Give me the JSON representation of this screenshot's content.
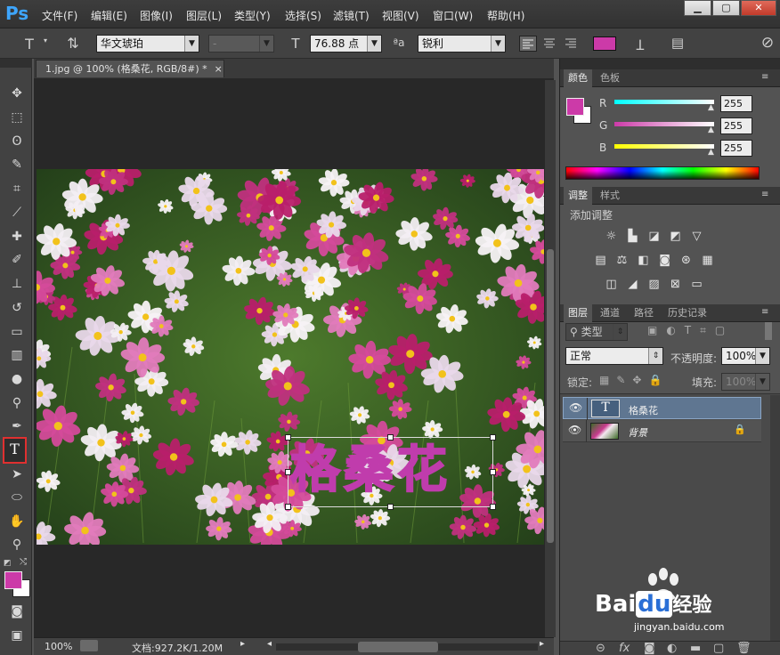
{
  "app": {
    "logo": "Ps",
    "menu": [
      "文件(F)",
      "编辑(E)",
      "图像(I)",
      "图层(L)",
      "类型(Y)",
      "选择(S)",
      "滤镜(T)",
      "视图(V)",
      "窗口(W)",
      "帮助(H)"
    ],
    "window_buttons": [
      "▁",
      "▢",
      "✕"
    ]
  },
  "options": {
    "font_family": "华文琥珀",
    "font_style": "-",
    "font_size": "76.88 点",
    "antialias_icon": "ªa",
    "antialias": "锐利",
    "text_color": "#cc3aa8"
  },
  "document": {
    "tab_title": "1.jpg @ 100% (格桑花, RGB/8#) *",
    "close": "×",
    "text_overlay": "格桑花",
    "text_color": "#c03cac"
  },
  "status": {
    "zoom": "100%",
    "doc_info": "文档:927.2K/1.20M"
  },
  "color_panel": {
    "tabs": [
      "颜色",
      "色板"
    ],
    "fg_color": "#cc3aa8",
    "bg_color": "#ffffff",
    "channels": [
      {
        "label": "R",
        "value": "255"
      },
      {
        "label": "G",
        "value": "255"
      },
      {
        "label": "B",
        "value": "255"
      }
    ]
  },
  "adjust_panel": {
    "tabs": [
      "调整",
      "样式"
    ],
    "title": "添加调整"
  },
  "layers_panel": {
    "tabs": [
      "图层",
      "通道",
      "路径",
      "历史记录"
    ],
    "filter": "类型",
    "blend_mode": "正常",
    "opacity_label": "不透明度:",
    "opacity": "100%",
    "lock_label": "锁定:",
    "fill_label": "填充:",
    "fill": "100%",
    "layers": [
      {
        "name": "格桑花",
        "type": "text",
        "selected": true
      },
      {
        "name": "背景",
        "type": "image",
        "locked": true
      }
    ]
  },
  "watermark": {
    "brand_a": "Bai",
    "brand_b": "du",
    "brand_c": "经验",
    "url": "jingyan.baidu.com"
  }
}
